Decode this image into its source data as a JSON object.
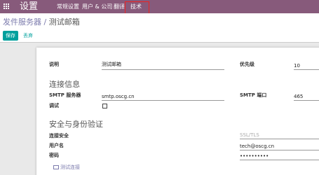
{
  "topbar": {
    "app_title": "设置",
    "menu": [
      "常规设置",
      "用户 & 公司",
      "翻译",
      "技术"
    ]
  },
  "breadcrumb": {
    "parent": "发件服务器",
    "separator": " / ",
    "current": "测试邮箱"
  },
  "toolbar": {
    "save_label": "保存",
    "discard_label": "丢弃"
  },
  "form": {
    "description_label": "说明",
    "description_value": "测试邮箱",
    "priority_label": "优先级",
    "priority_value": "10",
    "connection_title": "连接信息",
    "smtp_server_label": "SMTP 服务器",
    "smtp_server_value": "smtp.oscg.cn",
    "smtp_port_label": "SMTP 端口",
    "smtp_port_value": "465",
    "debug_label": "调试",
    "security_title": "安全与身份验证",
    "connection_security_label": "连接安全",
    "connection_security_value": "SSL/TLS",
    "username_label": "用户名",
    "username_value": "tech@oscg.cn",
    "password_label": "密码",
    "password_value": "••••••••••",
    "test_connection_label": "测试连接"
  },
  "colors": {
    "topbar": "#875a7b",
    "primary": "#00a09d",
    "link": "#7c7bad"
  },
  "icons": [
    "apps-icon",
    "monitor-icon"
  ]
}
